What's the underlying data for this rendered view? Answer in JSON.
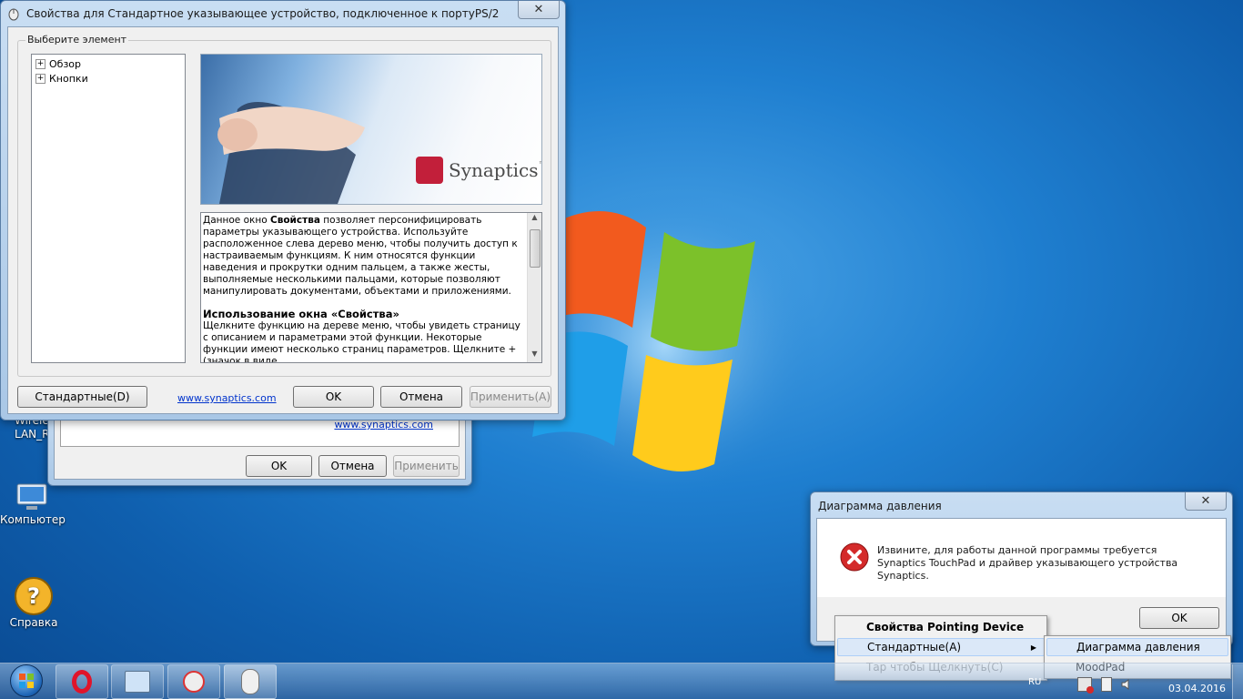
{
  "desktop": {
    "icons": [
      {
        "label": "Wirele\nLAN_Rea"
      },
      {
        "label": "Компьютер"
      },
      {
        "label": "Справка"
      }
    ]
  },
  "back_window": {
    "link": "www.synaptics.com",
    "ok": "OK",
    "cancel": "Отмена",
    "apply": "Применить"
  },
  "main_window": {
    "title": "Свойства для Стандартное указывающее устройство, подключенное к портуPS/2",
    "group_label": "Выберите элемент",
    "tree": [
      "Обзор",
      "Кнопки"
    ],
    "brand": "Synaptics",
    "brand_tm": "™",
    "desc_p1_a": "Данное окно ",
    "desc_p1_b": "Свойства",
    "desc_p1_c": " позволяет персонифицировать параметры указывающего устройства. Используйте расположенное слева дерево меню, чтобы получить доступ к настраиваемым функциям. К ним относятся функции наведения и прокрутки одним пальцем, а также жесты, выполняемые несколькими пальцами, которые позволяют манипулировать документами, объектами и приложениями.",
    "desc_h2": "Использование окна «Свойства»",
    "desc_p2": "Щелкните функцию на дереве меню, чтобы увидеть страницу с описанием и параметрами этой функции. Некоторые функции имеют несколько страниц параметров. Щелкните + (значок в виде",
    "btn_defaults": "Стандартные(D)",
    "link": "www.synaptics.com",
    "btn_ok": "OK",
    "btn_cancel": "Отмена",
    "btn_apply": "Применить(A)"
  },
  "error_dialog": {
    "title": "Диаграмма давления",
    "message": "Извините, для работы данной программы требуется Synaptics TouchPad и драйвер указывающего устройства Synaptics.",
    "ok": "OK"
  },
  "context_menu": {
    "items": [
      "Свойства Pointing Device",
      "Стандартные(A)",
      "Тар чтобы Щелкнуть(C)"
    ],
    "submenu": [
      "Диаграмма давления",
      "MoodPad"
    ]
  },
  "taskbar": {
    "lang": "RU",
    "date": "03.04.2016"
  },
  "colors": {
    "link": "#0033cc",
    "error_red": "#d42a2a",
    "menu_highlight": "#dbe8f8"
  }
}
